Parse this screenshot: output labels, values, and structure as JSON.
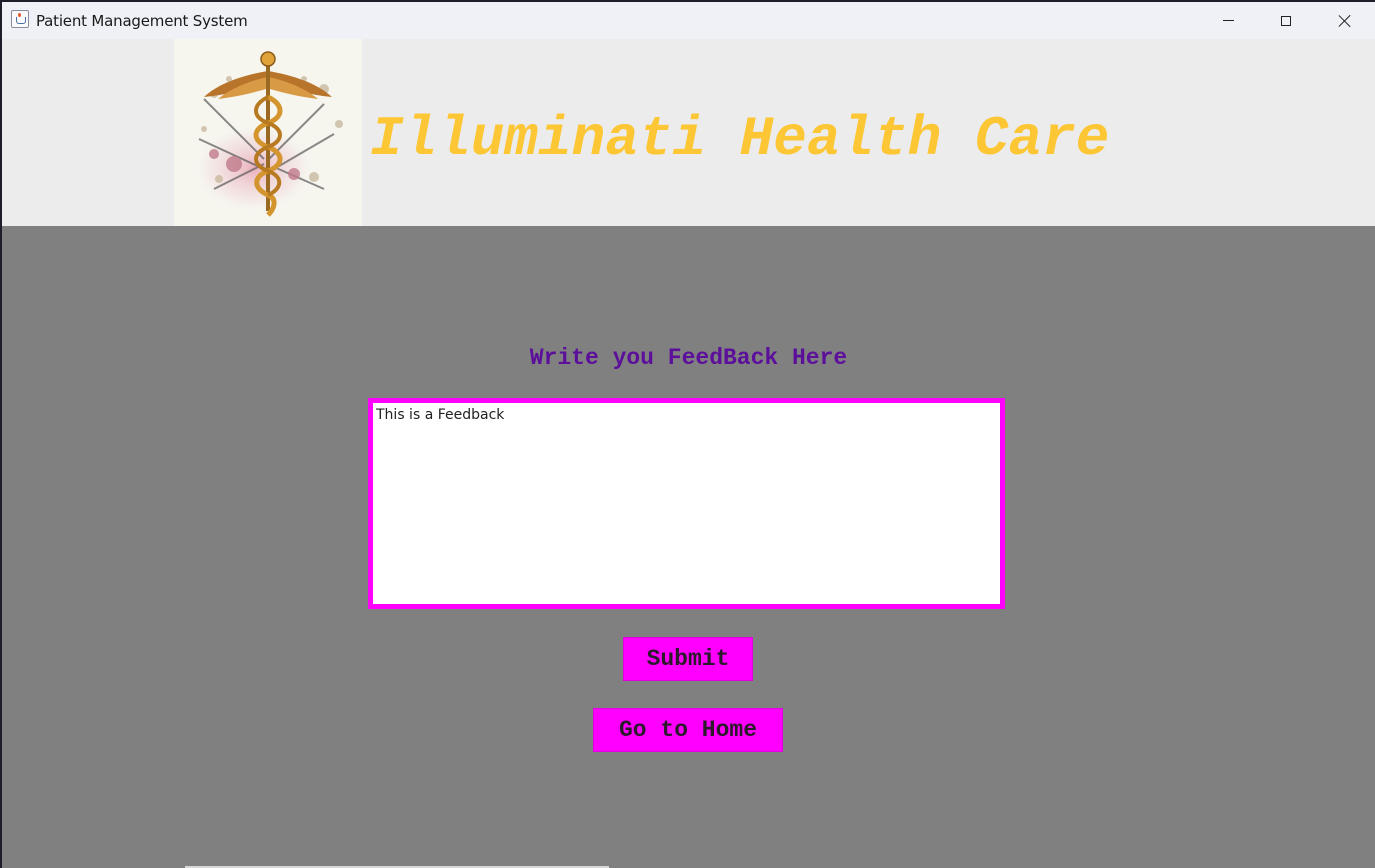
{
  "window": {
    "title": "Patient Management System",
    "controls": [
      "minimize",
      "maximize",
      "close"
    ]
  },
  "header": {
    "logo_icon": "caduceus-icon",
    "brand_title": "Illuminati Health Care"
  },
  "feedback": {
    "heading": "Write you FeedBack Here",
    "text_value": "This is a Feedback"
  },
  "buttons": {
    "submit_label": "Submit",
    "home_label": "Go to Home"
  },
  "colors": {
    "background": "#808080",
    "header_band": "#ececec",
    "brand_title": "#fcc634",
    "heading": "#5c0f9a",
    "accent_magenta": "#ff00ff"
  }
}
